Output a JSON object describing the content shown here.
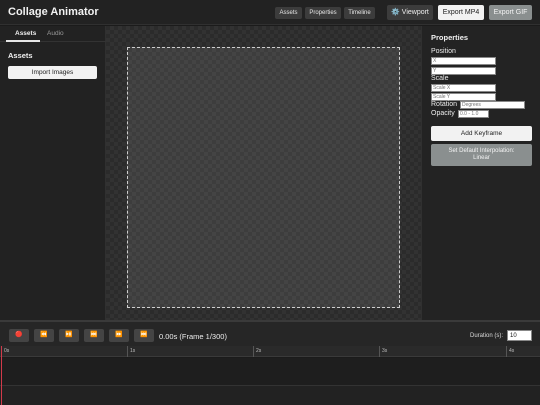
{
  "header": {
    "title": "Collage Animator",
    "panel_toggles": [
      "Assets",
      "Properties",
      "Timeline"
    ],
    "viewport_label": "⚙️ Viewport",
    "export_mp4": "Export MP4",
    "export_gif": "Export GIF"
  },
  "left_panel": {
    "tabs": [
      {
        "label": "Assets",
        "active": true
      },
      {
        "label": "Audio",
        "active": false
      }
    ],
    "section_title": "Assets",
    "import_button": "Import Images"
  },
  "properties": {
    "title": "Properties",
    "position_label": "Position",
    "x_placeholder": "X",
    "y_placeholder": "Y",
    "scale_label": "Scale",
    "scale_x_placeholder": "Scale X",
    "scale_y_placeholder": "Scale Y",
    "rotation_label": "Rotation",
    "rotation_placeholder": "Degrees",
    "opacity_label": "Opacity",
    "opacity_placeholder": "0.0 - 1.0",
    "add_keyframe": "Add Keyframe",
    "default_interp_line1": "Set Default Interpolation:",
    "default_interp_line2": "Linear"
  },
  "transport": {
    "buttons": [
      {
        "name": "record",
        "glyph": "🔴"
      },
      {
        "name": "rewind",
        "glyph": "⏪"
      },
      {
        "name": "step-back",
        "glyph": "⏯️"
      },
      {
        "name": "play",
        "glyph": "⏭️"
      },
      {
        "name": "step-forward",
        "glyph": "⏩"
      },
      {
        "name": "end",
        "glyph": "⏭️"
      }
    ],
    "time_readout": "0.00s (Frame 1/300)",
    "duration_label": "Duration (s):",
    "duration_value": "10"
  },
  "timeline": {
    "ticks": [
      "0s",
      "1s",
      "2s",
      "3s",
      "4s"
    ]
  },
  "colors": {
    "accent_playhead": "#d23a4a",
    "button_light": "#f2f2f2",
    "interp_button": "#8a8f8f"
  }
}
